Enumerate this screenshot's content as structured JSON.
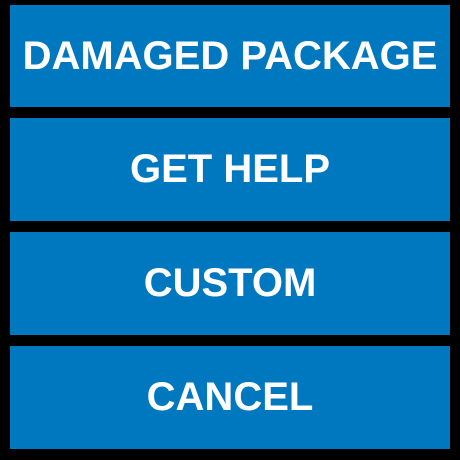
{
  "menu": {
    "items": [
      {
        "label": "DAMAGED PACKAGE"
      },
      {
        "label": "GET HELP"
      },
      {
        "label": "CUSTOM"
      },
      {
        "label": "CANCEL"
      }
    ]
  },
  "colors": {
    "background": "#000000",
    "button": "#0078bf",
    "text": "#ffffff"
  }
}
